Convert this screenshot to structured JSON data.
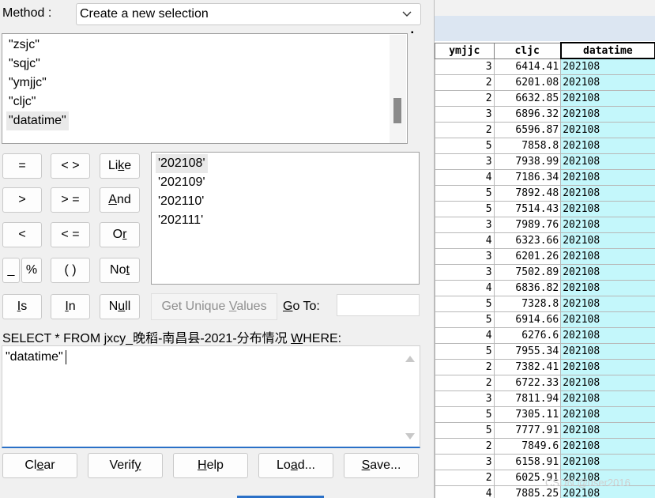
{
  "method": {
    "label": "Method :",
    "value": "Create a new selection"
  },
  "fields": [
    "\"zsjc\"",
    "\"sqjc\"",
    "\"ymjjc\"",
    "\"cljc\"",
    "\"datatime\""
  ],
  "selected_field_index": 4,
  "operators": {
    "eq": "=",
    "ne": "< >",
    "like": "Like",
    "gt": ">",
    "ge": "> =",
    "and": "And",
    "lt": "<",
    "le": "< =",
    "or": "Or",
    "underscore": "_",
    "percent": "%",
    "parens": "( )",
    "not": "Not",
    "is": "Is",
    "in": "In",
    "null": "Null"
  },
  "values": [
    "'202108'",
    "'202109'",
    "'202110'",
    "'202111'"
  ],
  "get_unique_values": "Get Unique Values",
  "goto_label": "Go To:",
  "goto_value": "",
  "sql_prefix": "SELECT * FROM jxcy_晚稻-南昌县-2021-分布情况 WHERE:",
  "expression": "\"datatime\"",
  "buttons": {
    "clear": "Clear",
    "verify": "Verify",
    "help": "Help",
    "load": "Load...",
    "save": "Save..."
  },
  "table": {
    "columns": [
      "ymjjc",
      "cljc",
      "datatime"
    ],
    "rows": [
      [
        "3",
        "6414.41",
        "202108"
      ],
      [
        "2",
        "6201.08",
        "202108"
      ],
      [
        "2",
        "6632.85",
        "202108"
      ],
      [
        "3",
        "6896.32",
        "202108"
      ],
      [
        "2",
        "6596.87",
        "202108"
      ],
      [
        "5",
        "7858.8",
        "202108"
      ],
      [
        "3",
        "7938.99",
        "202108"
      ],
      [
        "4",
        "7186.34",
        "202108"
      ],
      [
        "5",
        "7892.48",
        "202108"
      ],
      [
        "5",
        "7514.43",
        "202108"
      ],
      [
        "3",
        "7989.76",
        "202108"
      ],
      [
        "4",
        "6323.66",
        "202108"
      ],
      [
        "3",
        "6201.26",
        "202108"
      ],
      [
        "3",
        "7502.89",
        "202108"
      ],
      [
        "4",
        "6836.82",
        "202108"
      ],
      [
        "5",
        "7328.8",
        "202108"
      ],
      [
        "5",
        "6914.66",
        "202108"
      ],
      [
        "4",
        "6276.6",
        "202108"
      ],
      [
        "5",
        "7955.34",
        "202108"
      ],
      [
        "2",
        "7382.41",
        "202108"
      ],
      [
        "2",
        "6722.33",
        "202108"
      ],
      [
        "3",
        "7811.94",
        "202108"
      ],
      [
        "5",
        "7305.11",
        "202108"
      ],
      [
        "5",
        "7777.91",
        "202108"
      ],
      [
        "2",
        "7849.6",
        "202108"
      ],
      [
        "3",
        "6158.91",
        "202108"
      ],
      [
        "2",
        "6025.91",
        "202108"
      ],
      [
        "4",
        "7885.25",
        "202108"
      ]
    ]
  },
  "watermark": "CSDN @user2016"
}
